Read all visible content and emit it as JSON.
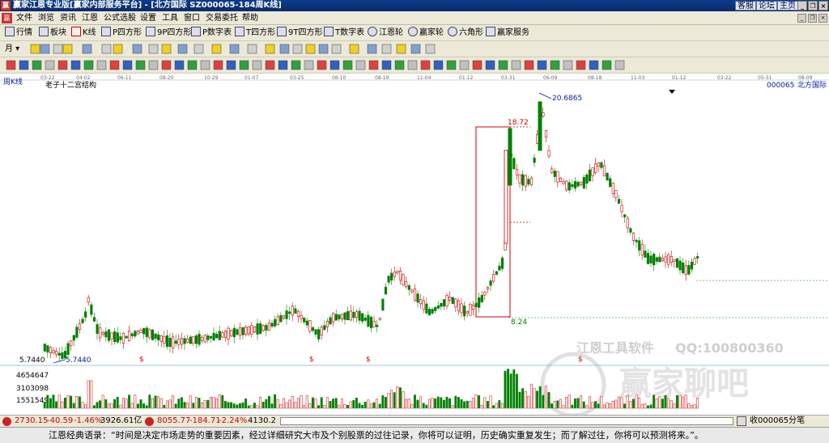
{
  "window": {
    "app_icon": "赢",
    "title": "赢家江恩专业版[赢家内部服务平台] - [北方国际  SZ000065-184周K线]",
    "links": [
      "客服",
      "论坛",
      "主页"
    ]
  },
  "menubar": {
    "items": [
      "文件",
      "浏览",
      "资讯",
      "江恩",
      "公式选股",
      "设置",
      "工具",
      "窗口",
      "交易委托",
      "帮助"
    ]
  },
  "toolbar1": {
    "items": [
      "行情",
      "板块",
      "K线",
      "P四方形",
      "9P四方形",
      "P数字表",
      "T四方形",
      "9T四方形",
      "T数字表",
      "江恩轮",
      "赢家轮",
      "六角形",
      "赢家服务"
    ]
  },
  "toolbar2": {
    "period": "月"
  },
  "chart": {
    "period_label": "周K线",
    "study_title": "老子十二宫结构",
    "stock_code": "000065",
    "stock_name": "北方国际",
    "price_high_label": "20.6865",
    "box_top_label": "18.72",
    "box_bottom_label": "8.24",
    "low_price_label": "5.7440",
    "axis_price_label": "5.7440",
    "volume_labels": [
      "4654647",
      "3103098",
      "1551549"
    ],
    "watermark_company": "江恩工具软件",
    "watermark_qq": "QQ:100800360",
    "watermark_logo": "赢家聊吧",
    "date_ticks": [
      "03-22",
      "04-02",
      "06-11",
      "08-20",
      "10-29",
      "01-07",
      "03-25",
      "06-10",
      "08-19",
      "11-04",
      "01-12",
      "03-31",
      "06-09",
      "08-18",
      "11-03",
      "01-12",
      "03-22",
      "05-31",
      "08-09"
    ]
  },
  "statusbar": {
    "index1_value": "2730.15",
    "index1_change": "-40.59",
    "index1_pct": "-1.46%",
    "index1_volume": "3926.61亿",
    "index2_value": "8055.77",
    "index2_change": "-184.71",
    "index2_pct": "-2.24%",
    "index2_volume": "4130.2",
    "right_info": "收000065分笔"
  },
  "bottom": {
    "quote": "江恩经典语录：“时间是决定市场走势的重要因素，经过详细研究大市及个别股票的过往记录，你将可以证明，历史确实重复发生；而了解过往，你将可以预测将来。”。"
  },
  "colors": {
    "up": "#d00000",
    "down": "#008000",
    "accent": "#001ea0"
  }
}
